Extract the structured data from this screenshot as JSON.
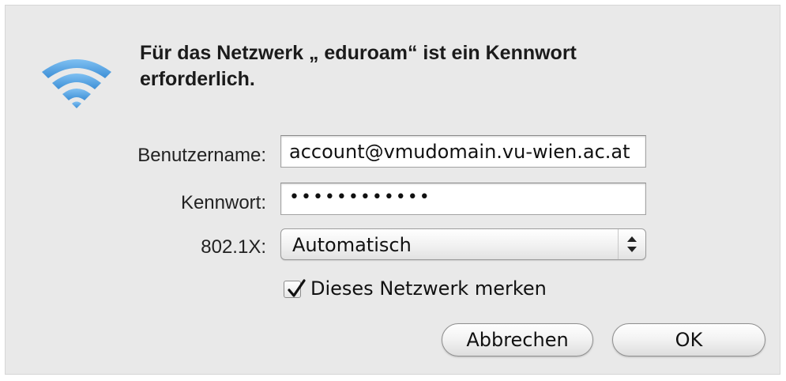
{
  "dialog": {
    "title": "Für das Netzwerk „ eduroam“ ist ein Kennwort erforderlich.",
    "icon": "wifi-icon"
  },
  "form": {
    "username_label": "Benutzername:",
    "username_value": "account@vmudomain.vu-wien.ac.at",
    "password_label": "Kennwort:",
    "password_value": "••••••••••••",
    "eap_label": "802.1X:",
    "eap_value": "Automatisch",
    "remember_label": "Dieses Netzwerk merken",
    "remember_checked": true
  },
  "buttons": {
    "cancel": "Abbrechen",
    "ok": "OK"
  },
  "colors": {
    "wifi": "#4f9ee0",
    "background": "#e9e9e9"
  }
}
